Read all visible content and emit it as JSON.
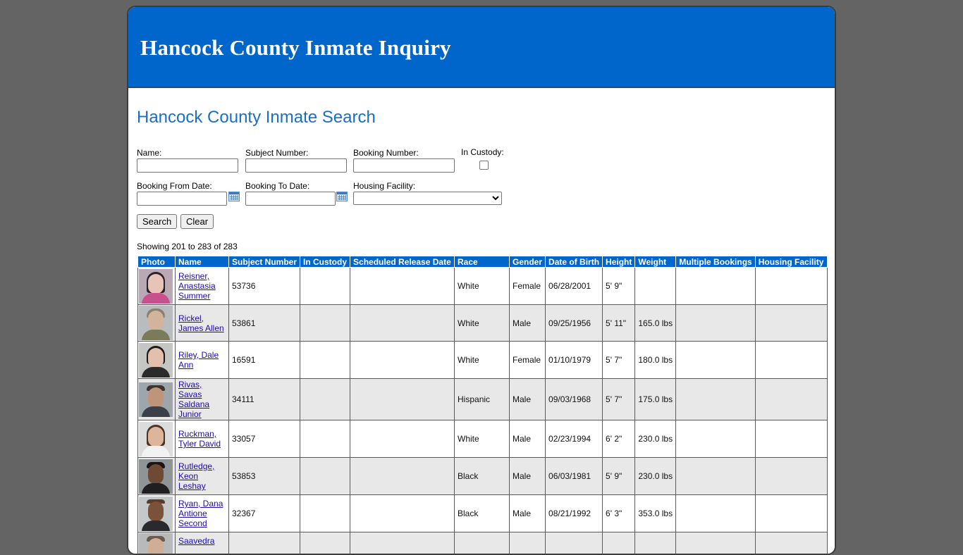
{
  "header": {
    "title": "Hancock County Inmate Inquiry"
  },
  "page_title": "Hancock County Inmate Search",
  "form": {
    "name_label": "Name:",
    "subject_number_label": "Subject Number:",
    "booking_number_label": "Booking Number:",
    "in_custody_label": "In Custody:",
    "booking_from_label": "Booking From Date:",
    "booking_to_label": "Booking To Date:",
    "housing_facility_label": "Housing Facility:",
    "search_button": "Search",
    "clear_button": "Clear"
  },
  "results": {
    "showing": "Showing 201 to 283 of 283",
    "columns": [
      "Photo",
      "Name",
      "Subject Number",
      "In Custody",
      "Scheduled Release Date",
      "Race",
      "Gender",
      "Date of Birth",
      "Height",
      "Weight",
      "Multiple Bookings",
      "Housing Facility"
    ],
    "rows": [
      {
        "name": "Reisner, Anastasia Summer",
        "subject": "53736",
        "in_custody": "",
        "release": "",
        "race": "White",
        "gender": "Female",
        "dob": "06/28/2001",
        "height": "5' 9\"",
        "weight": "",
        "multiple": "",
        "facility": ""
      },
      {
        "name": "Rickel, James Allen",
        "subject": "53861",
        "in_custody": "",
        "release": "",
        "race": "White",
        "gender": "Male",
        "dob": "09/25/1956",
        "height": "5' 11\"",
        "weight": "165.0 lbs",
        "multiple": "",
        "facility": ""
      },
      {
        "name": "Riley, Dale Ann",
        "subject": "16591",
        "in_custody": "",
        "release": "",
        "race": "White",
        "gender": "Female",
        "dob": "01/10/1979",
        "height": "5' 7\"",
        "weight": "180.0 lbs",
        "multiple": "",
        "facility": ""
      },
      {
        "name": "Rivas, Savas Saldana Junior",
        "subject": "34111",
        "in_custody": "",
        "release": "",
        "race": "Hispanic",
        "gender": "Male",
        "dob": "09/03/1968",
        "height": "5' 7\"",
        "weight": "175.0 lbs",
        "multiple": "",
        "facility": ""
      },
      {
        "name": "Ruckman, Tyler David",
        "subject": "33057",
        "in_custody": "",
        "release": "",
        "race": "White",
        "gender": "Male",
        "dob": "02/23/1994",
        "height": "6' 2\"",
        "weight": "230.0 lbs",
        "multiple": "",
        "facility": ""
      },
      {
        "name": "Rutledge, Keon Leshay",
        "subject": "53853",
        "in_custody": "",
        "release": "",
        "race": "Black",
        "gender": "Male",
        "dob": "06/03/1981",
        "height": "5' 9\"",
        "weight": "230.0 lbs",
        "multiple": "",
        "facility": ""
      },
      {
        "name": "Ryan, Dana Antione Second",
        "subject": "32367",
        "in_custody": "",
        "release": "",
        "race": "Black",
        "gender": "Male",
        "dob": "08/21/1992",
        "height": "6' 3\"",
        "weight": "353.0 lbs",
        "multiple": "",
        "facility": ""
      },
      {
        "name": "Saavedra",
        "subject": "",
        "in_custody": "",
        "release": "",
        "race": "",
        "gender": "",
        "dob": "",
        "height": "",
        "weight": "",
        "multiple": "",
        "facility": ""
      }
    ]
  },
  "colors": {
    "banner": "#0066cc",
    "title": "#1a6fc4",
    "link": "#1a0dab",
    "background": "#646464",
    "alt_row": "#e8e8e8"
  }
}
